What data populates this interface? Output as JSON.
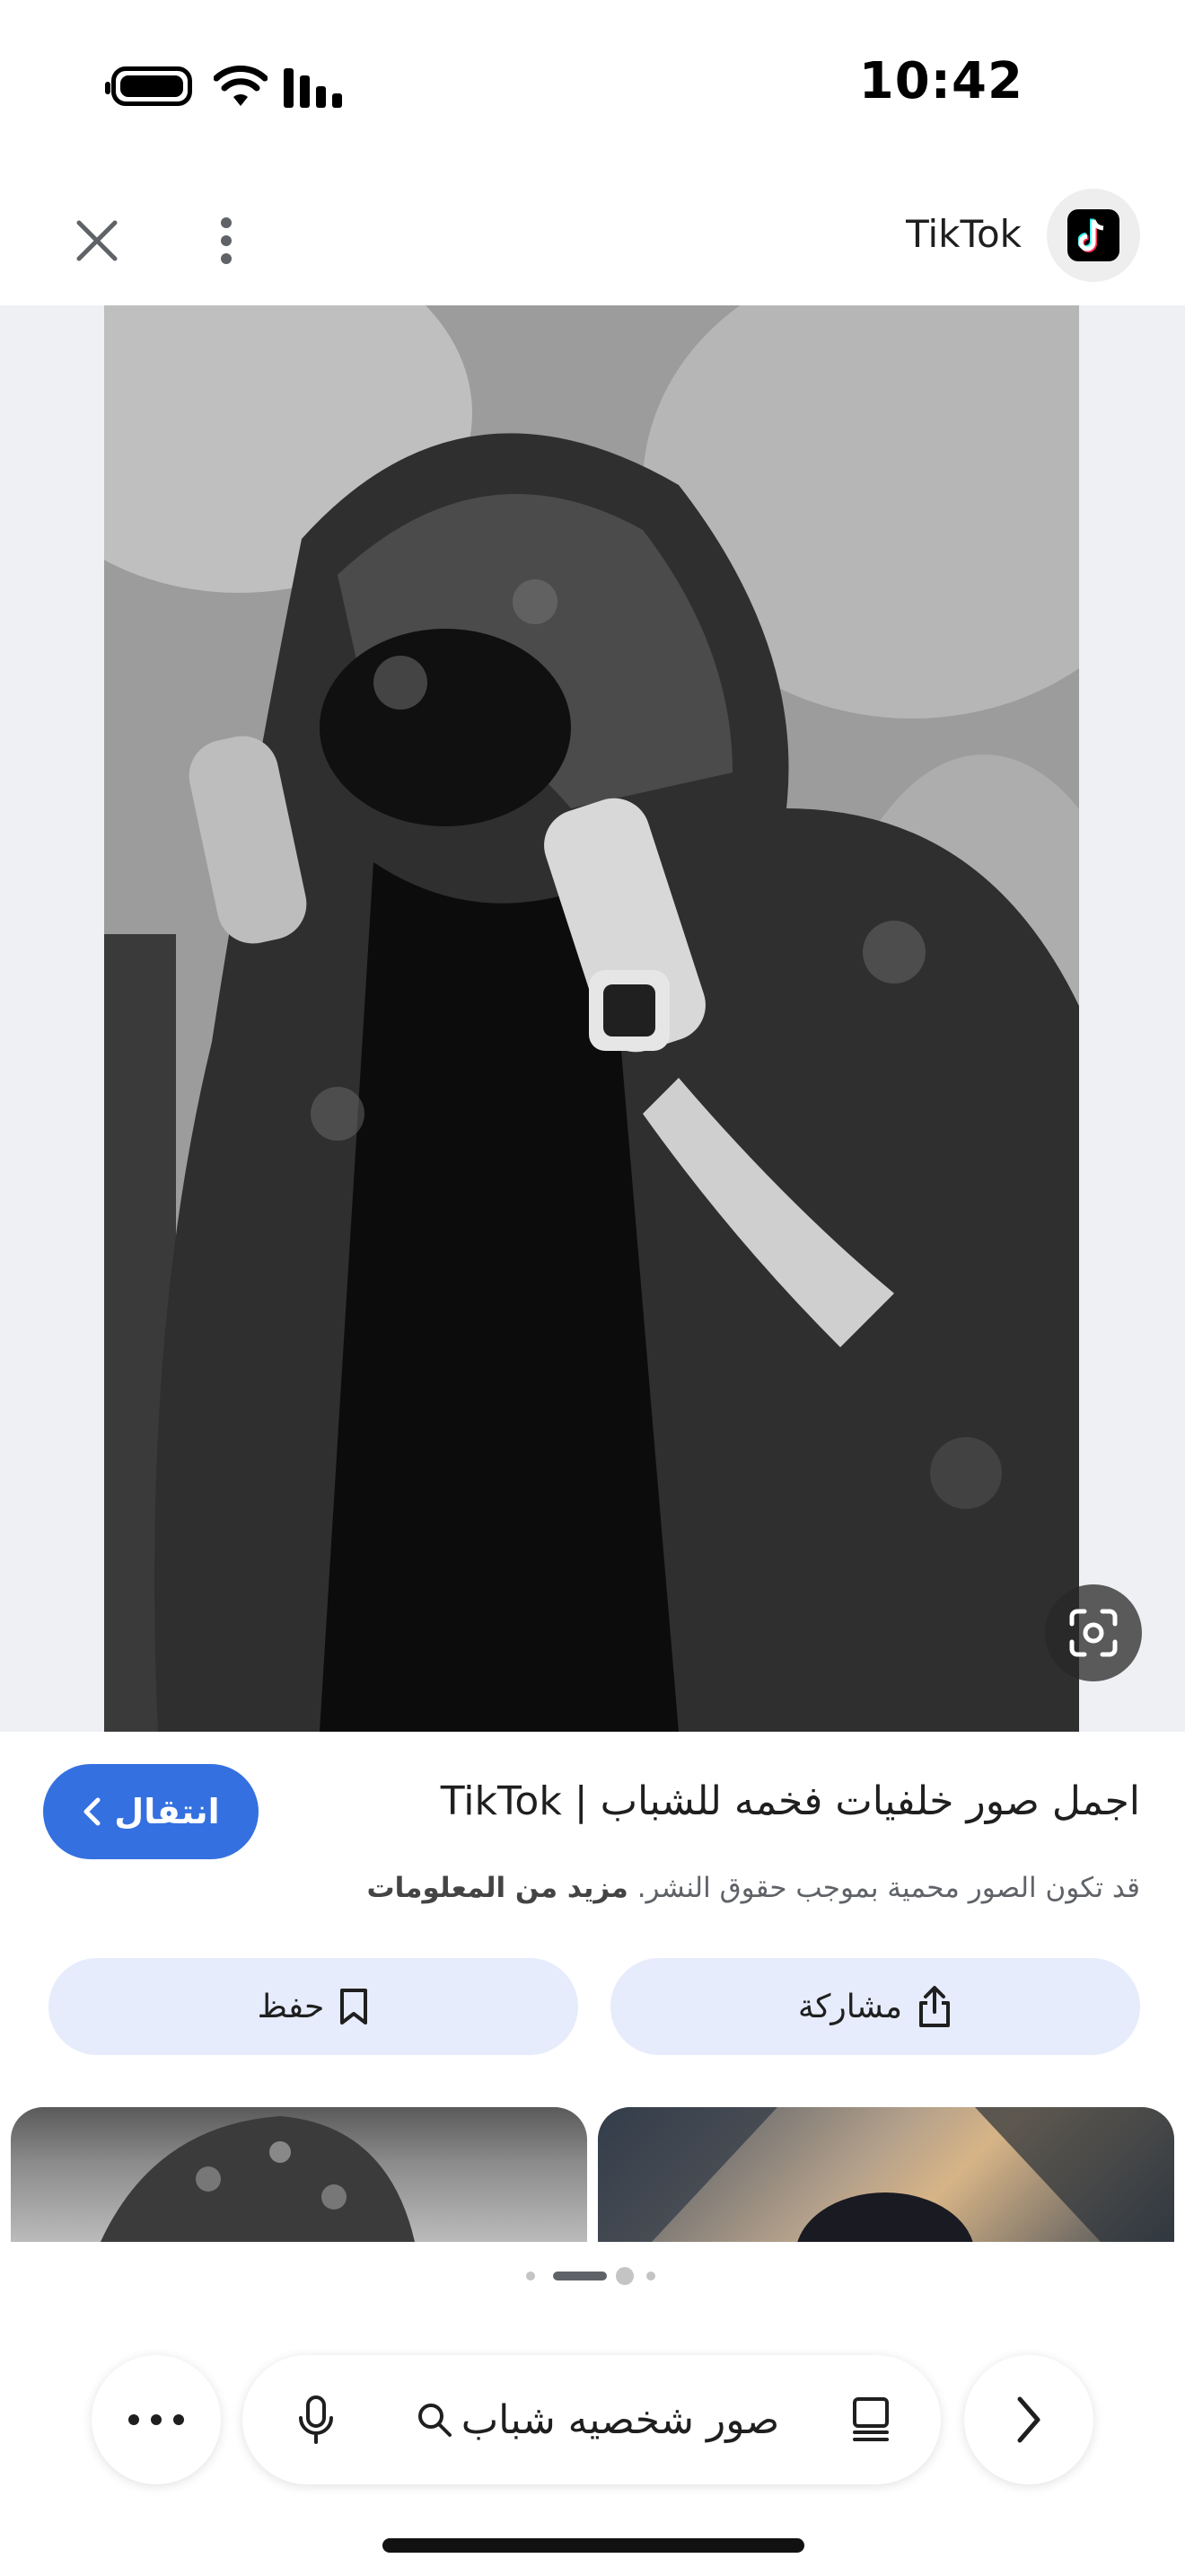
{
  "status_bar": {
    "time": "10:42"
  },
  "header": {
    "source_name": "TikTok",
    "source_logo": "tiktok-logo",
    "close_icon": "close-icon",
    "more_icon": "more-vert-icon"
  },
  "viewer": {
    "lens_icon": "lens-icon"
  },
  "result": {
    "title": "اجمل صور خلفيات فخمه للشباب | TikTok",
    "go_label": "انتقال",
    "copyright_text": "قد تكون الصور محمية بموجب حقوق النشر.",
    "more_info": "مزيد من المعلومات"
  },
  "actions": {
    "share_label": "مشاركة",
    "save_label": "حفظ"
  },
  "pager": {
    "count": 4,
    "active_index": 1
  },
  "bottom_bar": {
    "query": "صور شخصيه شباب"
  },
  "colors": {
    "accent": "#3470e0",
    "pill_bg": "#e6ecfb"
  }
}
